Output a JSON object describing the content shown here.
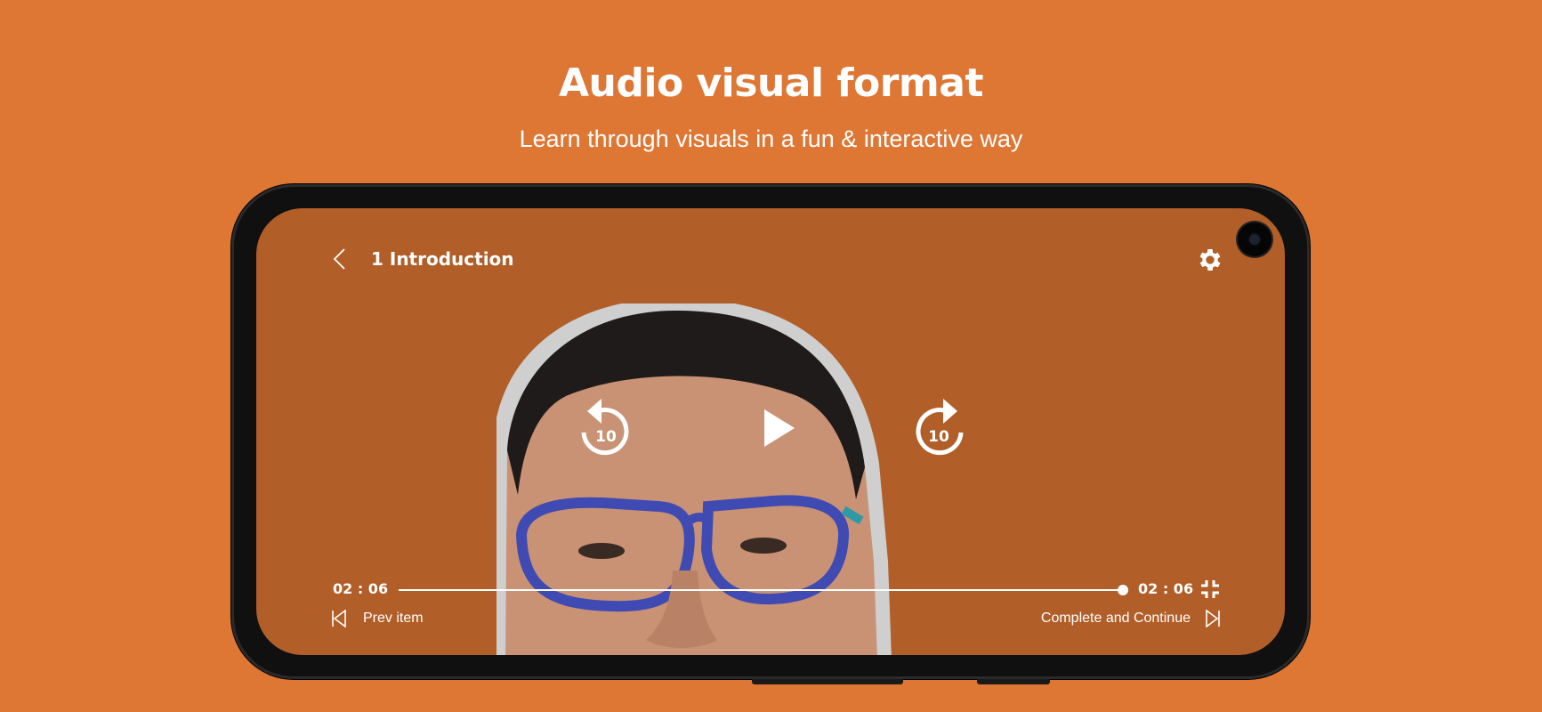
{
  "page": {
    "headline": "Audio visual format",
    "subheadline": "Learn through visuals in a fun & interactive way"
  },
  "player": {
    "lesson_title": "1 Introduction",
    "icons": {
      "back": "chevron-left-icon",
      "settings": "gear-icon",
      "rewind": "rewind-10-icon",
      "play": "play-icon",
      "forward": "forward-10-icon",
      "exit_fullscreen": "exit-fullscreen-icon",
      "prev": "skip-previous-icon",
      "next": "skip-next-icon"
    },
    "skip_seconds": "10",
    "current_time": "02 : 06",
    "duration": "02 : 06",
    "progress": 1.0,
    "prev_label": "Prev item",
    "next_label": "Complete and Continue"
  },
  "colors": {
    "background": "#DE7634",
    "screen": "#B15E28",
    "text": "#FFFFFF"
  }
}
